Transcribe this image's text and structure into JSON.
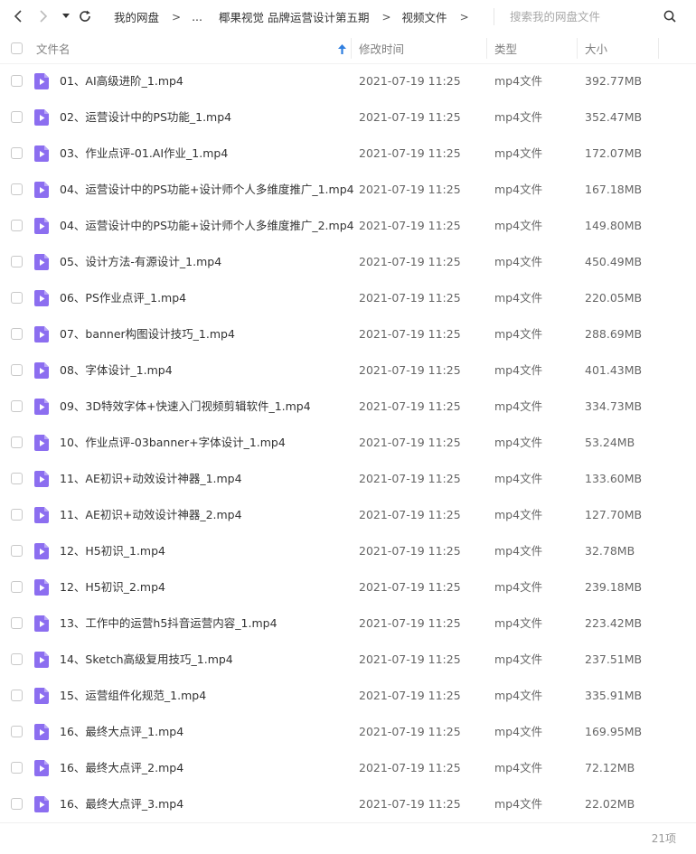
{
  "toolbar": {
    "back_icon": "back-arrow-icon",
    "forward_icon": "forward-arrow-icon",
    "history_icon": "dropdown-caret-icon",
    "refresh_icon": "refresh-icon"
  },
  "breadcrumb": {
    "items": [
      "我的网盘",
      "...",
      "椰果视觉 品牌运营设计第五期",
      "视频文件"
    ],
    "separator": ">"
  },
  "search": {
    "placeholder": "搜索我的网盘文件",
    "icon": "search-icon"
  },
  "columns": {
    "name": "文件名",
    "modified": "修改时间",
    "type": "类型",
    "size": "大小",
    "sort_icon": "sort-ascending-arrow-icon"
  },
  "colors": {
    "accent": "#2f7fe0",
    "file_icon": "#8c6ef0"
  },
  "files": [
    {
      "name": "01、AI高级进阶_1.mp4",
      "modified": "2021-07-19 11:25",
      "type": "mp4文件",
      "size": "392.77MB"
    },
    {
      "name": "02、运营设计中的PS功能_1.mp4",
      "modified": "2021-07-19 11:25",
      "type": "mp4文件",
      "size": "352.47MB"
    },
    {
      "name": "03、作业点评-01.AI作业_1.mp4",
      "modified": "2021-07-19 11:25",
      "type": "mp4文件",
      "size": "172.07MB"
    },
    {
      "name": "04、运营设计中的PS功能+设计师个人多维度推广_1.mp4",
      "modified": "2021-07-19 11:25",
      "type": "mp4文件",
      "size": "167.18MB"
    },
    {
      "name": "04、运营设计中的PS功能+设计师个人多维度推广_2.mp4",
      "modified": "2021-07-19 11:25",
      "type": "mp4文件",
      "size": "149.80MB"
    },
    {
      "name": "05、设计方法-有源设计_1.mp4",
      "modified": "2021-07-19 11:25",
      "type": "mp4文件",
      "size": "450.49MB"
    },
    {
      "name": "06、PS作业点评_1.mp4",
      "modified": "2021-07-19 11:25",
      "type": "mp4文件",
      "size": "220.05MB"
    },
    {
      "name": "07、banner构图设计技巧_1.mp4",
      "modified": "2021-07-19 11:25",
      "type": "mp4文件",
      "size": "288.69MB"
    },
    {
      "name": "08、字体设计_1.mp4",
      "modified": "2021-07-19 11:25",
      "type": "mp4文件",
      "size": "401.43MB"
    },
    {
      "name": "09、3D特效字体+快速入门视频剪辑软件_1.mp4",
      "modified": "2021-07-19 11:25",
      "type": "mp4文件",
      "size": "334.73MB"
    },
    {
      "name": "10、作业点评-03banner+字体设计_1.mp4",
      "modified": "2021-07-19 11:25",
      "type": "mp4文件",
      "size": "53.24MB"
    },
    {
      "name": "11、AE初识+动效设计神器_1.mp4",
      "modified": "2021-07-19 11:25",
      "type": "mp4文件",
      "size": "133.60MB"
    },
    {
      "name": "11、AE初识+动效设计神器_2.mp4",
      "modified": "2021-07-19 11:25",
      "type": "mp4文件",
      "size": "127.70MB"
    },
    {
      "name": "12、H5初识_1.mp4",
      "modified": "2021-07-19 11:25",
      "type": "mp4文件",
      "size": "32.78MB"
    },
    {
      "name": "12、H5初识_2.mp4",
      "modified": "2021-07-19 11:25",
      "type": "mp4文件",
      "size": "239.18MB"
    },
    {
      "name": "13、工作中的运营h5抖音运营内容_1.mp4",
      "modified": "2021-07-19 11:25",
      "type": "mp4文件",
      "size": "223.42MB"
    },
    {
      "name": "14、Sketch高级复用技巧_1.mp4",
      "modified": "2021-07-19 11:25",
      "type": "mp4文件",
      "size": "237.51MB"
    },
    {
      "name": "15、运营组件化规范_1.mp4",
      "modified": "2021-07-19 11:25",
      "type": "mp4文件",
      "size": "335.91MB"
    },
    {
      "name": "16、最终大点评_1.mp4",
      "modified": "2021-07-19 11:25",
      "type": "mp4文件",
      "size": "169.95MB"
    },
    {
      "name": "16、最终大点评_2.mp4",
      "modified": "2021-07-19 11:25",
      "type": "mp4文件",
      "size": "72.12MB"
    },
    {
      "name": "16、最终大点评_3.mp4",
      "modified": "2021-07-19 11:25",
      "type": "mp4文件",
      "size": "22.02MB"
    }
  ],
  "footer": {
    "count": "21项"
  }
}
